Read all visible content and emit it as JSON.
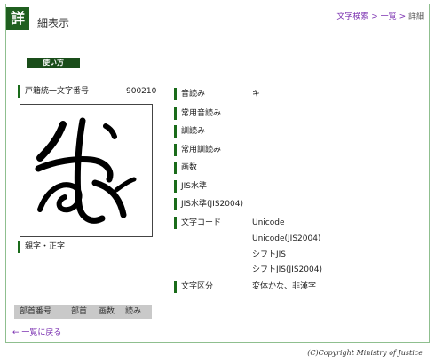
{
  "header": {
    "logo_char": "詳",
    "title": "細表示",
    "breadcrumb": {
      "search": "文字検索",
      "sep1": ">",
      "list": "一覧",
      "sep2": ">",
      "current": "詳細"
    }
  },
  "howto_button": "使い方",
  "left": {
    "code_label": "戸籍統一文字番号",
    "code_value": "900210",
    "parent_label": "親字・正字",
    "kanji_image_icon": "hentaigana-glyph-image"
  },
  "table_header": [
    "部首番号",
    "部首",
    "画数",
    "読み"
  ],
  "back_link": "← 一覧に戻る",
  "fields": [
    {
      "label": "音読み",
      "values": [
        "キ"
      ]
    },
    {
      "label": "常用音読み",
      "values": []
    },
    {
      "label": "訓読み",
      "values": []
    },
    {
      "label": "常用訓読み",
      "values": []
    },
    {
      "label": "画数",
      "values": []
    },
    {
      "label": "JIS水準",
      "values": []
    },
    {
      "label": "JIS水準(JIS2004)",
      "values": []
    },
    {
      "label": "文字コード",
      "values": [
        "Unicode",
        "Unicode(JIS2004)",
        "シフトJIS",
        "シフトJIS(JIS2004)"
      ]
    },
    {
      "label": "文字区分",
      "values": [
        "変体かな、非漢字"
      ]
    }
  ],
  "copyright": "(C)Copyright Ministry of Justice",
  "colors": {
    "accent_green": "#1a6b1a",
    "link_purple": "#7a2fb0",
    "frame_green": "#8fbf8f"
  }
}
